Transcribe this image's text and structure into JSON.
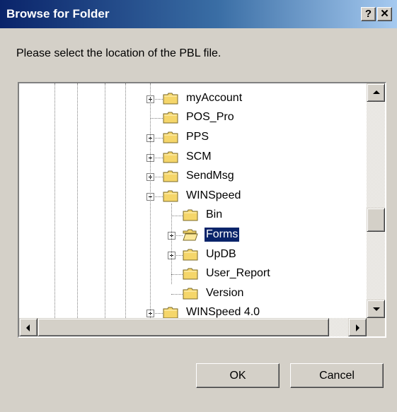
{
  "window": {
    "title": "Browse for Folder",
    "help_label": "?",
    "close_label": "✕"
  },
  "prompt": "Please select the location of the PBL file.",
  "tree": {
    "items": [
      {
        "label": "myAccount",
        "expander": "plus",
        "selected": false
      },
      {
        "label": "POS_Pro",
        "expander": "none",
        "selected": false
      },
      {
        "label": "PPS",
        "expander": "plus",
        "selected": false
      },
      {
        "label": "SCM",
        "expander": "plus",
        "selected": false
      },
      {
        "label": "SendMsg",
        "expander": "plus",
        "selected": false
      },
      {
        "label": "WINSpeed",
        "expander": "minus",
        "selected": false
      },
      {
        "label": "Bin",
        "expander": "none",
        "selected": false
      },
      {
        "label": "Forms",
        "expander": "plus",
        "selected": true
      },
      {
        "label": "UpDB",
        "expander": "plus",
        "selected": false
      },
      {
        "label": "User_Report",
        "expander": "none",
        "selected": false
      },
      {
        "label": "Version",
        "expander": "none",
        "selected": false
      },
      {
        "label": "WINSpeed 4.0",
        "expander": "plus",
        "selected": false
      }
    ]
  },
  "buttons": {
    "ok": "OK",
    "cancel": "Cancel"
  },
  "colors": {
    "selection": "#0a246a",
    "title_start": "#0a246a",
    "title_end": "#a6caf0",
    "face": "#d4d0c8",
    "folder": "#f5d66a"
  }
}
